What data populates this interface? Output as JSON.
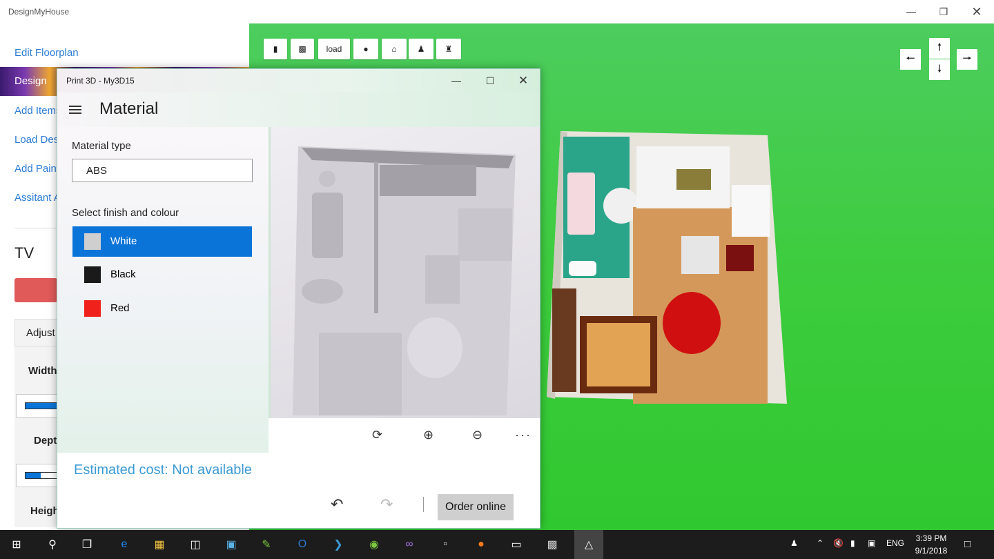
{
  "app": {
    "title": "DesignMyHouse"
  },
  "sidebar": {
    "items": [
      {
        "label": "Edit Floorplan"
      },
      {
        "label": "Design"
      },
      {
        "label": "Add Items"
      },
      {
        "label": "Load Des"
      },
      {
        "label": "Add Pain"
      },
      {
        "label": "Assitant A"
      }
    ],
    "section_title": "TV",
    "adjust_tab": "Adjust",
    "width_label": "Width",
    "depth_label": "Dept",
    "height_label": "Heigh"
  },
  "toolbar": {
    "load_label": "load"
  },
  "print3d": {
    "window_title": "Print 3D - My3D15",
    "header": "Material",
    "material_type_label": "Material type",
    "material_type_value": "ABS",
    "finish_label": "Select finish and colour",
    "finishes": [
      {
        "label": "White",
        "color": "#cfcfcf",
        "selected": true
      },
      {
        "label": "Black",
        "color": "#1a1a1a",
        "selected": false
      },
      {
        "label": "Red",
        "color": "#f0211b",
        "selected": false
      }
    ],
    "estimated_cost": "Estimated cost: Not available",
    "order_label": "Order online"
  },
  "taskbar": {
    "lang": "ENG",
    "time": "3:39 PM",
    "date": "9/1/2018"
  },
  "colors": {
    "viewport_green": "#3dcc3d",
    "accent_blue": "#0b74d8",
    "link_blue": "#2a7bd5",
    "cost_blue": "#3b9bd5"
  }
}
